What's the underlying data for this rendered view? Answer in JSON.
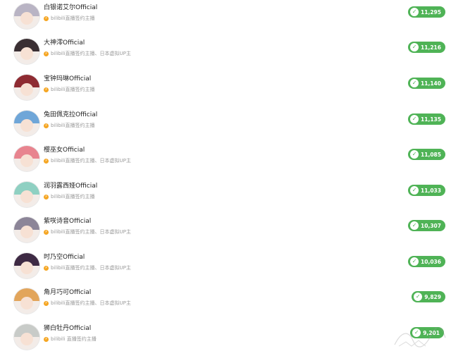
{
  "rows": [
    {
      "name": "白银诺艾尔Official",
      "tag": "bilibili直播签约主播",
      "count": "11,295",
      "hair": "#b9b4c4"
    },
    {
      "name": "大神澪Official",
      "tag": "bilibili直播签约主播、日本虚拟UP主",
      "count": "11,216",
      "hair": "#3a2f33"
    },
    {
      "name": "宝钟玛琳Official",
      "tag": "bilibili直播签约主播",
      "count": "11,140",
      "hair": "#8e2b32"
    },
    {
      "name": "兔田佩克拉Official",
      "tag": "bilibili直播签约主播",
      "count": "11,135",
      "hair": "#6fa6d8"
    },
    {
      "name": "樱巫女Official",
      "tag": "bilibili直播签约主播、日本虚拟UP主",
      "count": "11,085",
      "hair": "#e8848f"
    },
    {
      "name": "润羽露西娅Official",
      "tag": "bilibili直播签约主播",
      "count": "11,033",
      "hair": "#8fd0c2"
    },
    {
      "name": "紫咲诗音Official",
      "tag": "bilibili直播签约主播、日本虚拟UP主",
      "count": "10,307",
      "hair": "#8c8598"
    },
    {
      "name": "时乃空Official",
      "tag": "bilibili直播签约主播、日本虚拟UP主",
      "count": "10,036",
      "hair": "#3e2a44"
    },
    {
      "name": "角月巧可Official",
      "tag": "bilibili直播签约主播、日本虚拟UP主",
      "count": "9,829",
      "hair": "#e2a55b"
    },
    {
      "name": "狮白牡丹Official",
      "tag": "bilibili 直播签约主播",
      "count": "9,201",
      "hair": "#c8cbc8"
    }
  ],
  "icons": {
    "verify": "verified-badge-icon",
    "badge": "heart-check-icon"
  },
  "colors": {
    "badge": "#4fb356",
    "verify": "#f5a623"
  }
}
